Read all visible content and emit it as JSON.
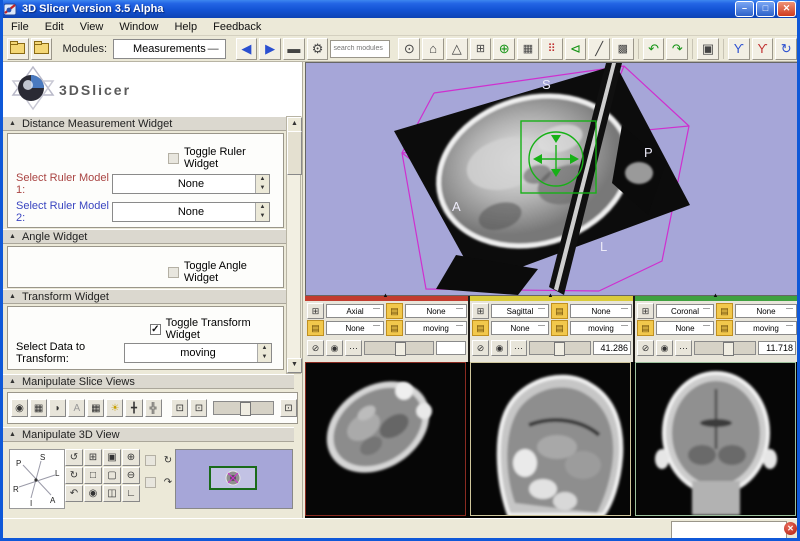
{
  "window": {
    "title": "3D Slicer Version 3.5 Alpha"
  },
  "menu": {
    "items": [
      "File",
      "Edit",
      "View",
      "Window",
      "Help",
      "Feedback"
    ]
  },
  "toolbar": {
    "modules_label": "Modules:",
    "module_selected": "Measurements",
    "search_placeholder": "search modules"
  },
  "icons": {
    "minimize": "–",
    "maximize": "□",
    "close": "✕",
    "module_prev": "◀",
    "module_next": "▶",
    "window_layout": "▬",
    "module_settings": "⚙",
    "find_module": "⊙",
    "home": "⌂",
    "view_3d": "△",
    "fiducial_grid": "⊞",
    "crosshair": "⊕",
    "volume_render": "▦",
    "fiducial_list": "⠿",
    "screen_capture": "⊲",
    "measure_line": "╱",
    "edit_grid": "▩",
    "undo": "↶",
    "redo": "↷",
    "screenshot": "▣",
    "person_blue": "ϒ",
    "person_red": "ϒ",
    "refresh_view": "↻",
    "sv_visibility": "◉",
    "sv_layout": "▦",
    "sv_sphere": "◗",
    "sv_label": "A",
    "sv_rgb": "▦",
    "sv_light": "☀",
    "sv_grid": "╋",
    "sv_move": "╬",
    "fit_window": "⊡",
    "fit_image": "⊡",
    "bg_toggle": "⊡",
    "v3_pitch": "↺",
    "v3_center": "⊞",
    "v3_snapshot": "▣",
    "v3_zoom_in": "⊕",
    "v3_yaw": "↻",
    "v3_box": "□",
    "v3_camera": "▢",
    "v3_zoom_out": "⊖",
    "v3_roll": "↶",
    "v3_look": "◉",
    "v3_stereo": "◫",
    "v3_ruler": "∟",
    "spin": "↻",
    "rock": "↷",
    "slice_options": "⊞",
    "layer_stack": "▤",
    "link_slices": "⊘",
    "visibility_eye": "◉",
    "slice_menu": "⋯",
    "collapse": "▲",
    "combo_indicator": "—",
    "spin_up": "▲",
    "spin_down": "▼",
    "check": "✓",
    "scroll_up": "▲",
    "scroll_down": "▼",
    "error_close": "✕"
  },
  "panel": {
    "logo_text": "3DSlicer",
    "distance": {
      "title": "Distance Measurement Widget",
      "toggle": "Toggle Ruler Widget",
      "ruler1_label": "Select Ruler Model 1:",
      "ruler1_value": "None",
      "ruler2_label": "Select Ruler Model 2:",
      "ruler2_value": "None"
    },
    "angle": {
      "title": "Angle Widget",
      "toggle": "Toggle Angle Widget"
    },
    "transform": {
      "title": "Transform Widget",
      "toggle": "Toggle Transform Widget",
      "data_label": "Select Data to Transform:",
      "data_value": "moving"
    },
    "slice_views": {
      "title": "Manipulate Slice Views"
    },
    "view3d": {
      "title": "Manipulate 3D View",
      "compass": {
        "p": "P",
        "s": "S",
        "l": "L",
        "r": "R",
        "i": "I",
        "a": "A"
      }
    }
  },
  "viewer3d": {
    "orientation_labels": {
      "s": "S",
      "p": "P",
      "l": "L",
      "a": "A"
    },
    "background_color": "#a6a6d8",
    "wireframe_color": "#cf2fcf",
    "widget_color": "#17b117"
  },
  "slices": {
    "panels": [
      {
        "orientation": "Axial",
        "foreground": "None",
        "label_layer": "None",
        "background": "moving",
        "slider_value": "",
        "bar_color": "#c23b2e"
      },
      {
        "orientation": "Sagittal",
        "foreground": "None",
        "label_layer": "None",
        "background": "moving",
        "slider_value": "41.286",
        "bar_color": "#d9cb3a"
      },
      {
        "orientation": "Coronal",
        "foreground": "None",
        "label_layer": "None",
        "background": "moving",
        "slider_value": "11.718",
        "bar_color": "#3fa13f"
      }
    ]
  },
  "statusbar": {
    "message": ""
  }
}
